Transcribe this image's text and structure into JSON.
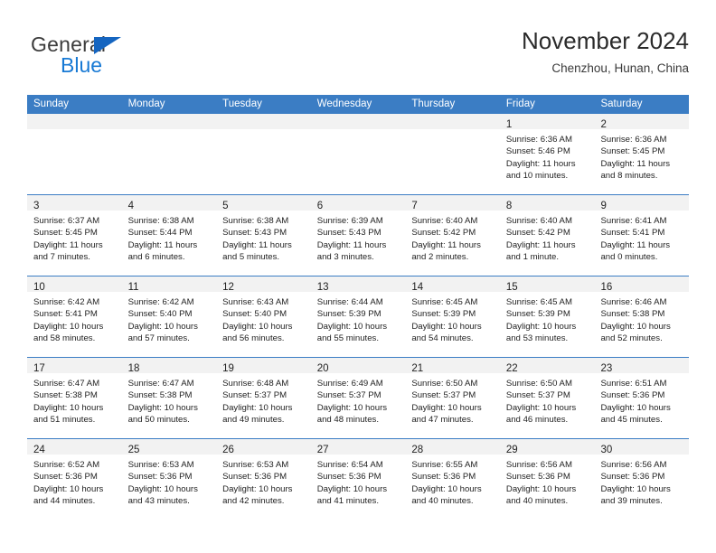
{
  "brand": {
    "name_top": "General",
    "name_bottom": "Blue",
    "accent_color": "#1779d4",
    "triangle_color": "#1565c0"
  },
  "header": {
    "title": "November 2024",
    "subtitle": "Chenzhou, Hunan, China"
  },
  "theme": {
    "header_row_bg": "#3b7dc4",
    "day_band_bg": "#f2f2f2",
    "row_divider": "#3b7dc4"
  },
  "weekdays": [
    "Sunday",
    "Monday",
    "Tuesday",
    "Wednesday",
    "Thursday",
    "Friday",
    "Saturday"
  ],
  "weeks": [
    [
      {
        "day": "",
        "sunrise": "",
        "sunset": "",
        "daylight": "",
        "daylight2": ""
      },
      {
        "day": "",
        "sunrise": "",
        "sunset": "",
        "daylight": "",
        "daylight2": ""
      },
      {
        "day": "",
        "sunrise": "",
        "sunset": "",
        "daylight": "",
        "daylight2": ""
      },
      {
        "day": "",
        "sunrise": "",
        "sunset": "",
        "daylight": "",
        "daylight2": ""
      },
      {
        "day": "",
        "sunrise": "",
        "sunset": "",
        "daylight": "",
        "daylight2": ""
      },
      {
        "day": "1",
        "sunrise": "Sunrise: 6:36 AM",
        "sunset": "Sunset: 5:46 PM",
        "daylight": "Daylight: 11 hours",
        "daylight2": "and 10 minutes."
      },
      {
        "day": "2",
        "sunrise": "Sunrise: 6:36 AM",
        "sunset": "Sunset: 5:45 PM",
        "daylight": "Daylight: 11 hours",
        "daylight2": "and 8 minutes."
      }
    ],
    [
      {
        "day": "3",
        "sunrise": "Sunrise: 6:37 AM",
        "sunset": "Sunset: 5:45 PM",
        "daylight": "Daylight: 11 hours",
        "daylight2": "and 7 minutes."
      },
      {
        "day": "4",
        "sunrise": "Sunrise: 6:38 AM",
        "sunset": "Sunset: 5:44 PM",
        "daylight": "Daylight: 11 hours",
        "daylight2": "and 6 minutes."
      },
      {
        "day": "5",
        "sunrise": "Sunrise: 6:38 AM",
        "sunset": "Sunset: 5:43 PM",
        "daylight": "Daylight: 11 hours",
        "daylight2": "and 5 minutes."
      },
      {
        "day": "6",
        "sunrise": "Sunrise: 6:39 AM",
        "sunset": "Sunset: 5:43 PM",
        "daylight": "Daylight: 11 hours",
        "daylight2": "and 3 minutes."
      },
      {
        "day": "7",
        "sunrise": "Sunrise: 6:40 AM",
        "sunset": "Sunset: 5:42 PM",
        "daylight": "Daylight: 11 hours",
        "daylight2": "and 2 minutes."
      },
      {
        "day": "8",
        "sunrise": "Sunrise: 6:40 AM",
        "sunset": "Sunset: 5:42 PM",
        "daylight": "Daylight: 11 hours",
        "daylight2": "and 1 minute."
      },
      {
        "day": "9",
        "sunrise": "Sunrise: 6:41 AM",
        "sunset": "Sunset: 5:41 PM",
        "daylight": "Daylight: 11 hours",
        "daylight2": "and 0 minutes."
      }
    ],
    [
      {
        "day": "10",
        "sunrise": "Sunrise: 6:42 AM",
        "sunset": "Sunset: 5:41 PM",
        "daylight": "Daylight: 10 hours",
        "daylight2": "and 58 minutes."
      },
      {
        "day": "11",
        "sunrise": "Sunrise: 6:42 AM",
        "sunset": "Sunset: 5:40 PM",
        "daylight": "Daylight: 10 hours",
        "daylight2": "and 57 minutes."
      },
      {
        "day": "12",
        "sunrise": "Sunrise: 6:43 AM",
        "sunset": "Sunset: 5:40 PM",
        "daylight": "Daylight: 10 hours",
        "daylight2": "and 56 minutes."
      },
      {
        "day": "13",
        "sunrise": "Sunrise: 6:44 AM",
        "sunset": "Sunset: 5:39 PM",
        "daylight": "Daylight: 10 hours",
        "daylight2": "and 55 minutes."
      },
      {
        "day": "14",
        "sunrise": "Sunrise: 6:45 AM",
        "sunset": "Sunset: 5:39 PM",
        "daylight": "Daylight: 10 hours",
        "daylight2": "and 54 minutes."
      },
      {
        "day": "15",
        "sunrise": "Sunrise: 6:45 AM",
        "sunset": "Sunset: 5:39 PM",
        "daylight": "Daylight: 10 hours",
        "daylight2": "and 53 minutes."
      },
      {
        "day": "16",
        "sunrise": "Sunrise: 6:46 AM",
        "sunset": "Sunset: 5:38 PM",
        "daylight": "Daylight: 10 hours",
        "daylight2": "and 52 minutes."
      }
    ],
    [
      {
        "day": "17",
        "sunrise": "Sunrise: 6:47 AM",
        "sunset": "Sunset: 5:38 PM",
        "daylight": "Daylight: 10 hours",
        "daylight2": "and 51 minutes."
      },
      {
        "day": "18",
        "sunrise": "Sunrise: 6:47 AM",
        "sunset": "Sunset: 5:38 PM",
        "daylight": "Daylight: 10 hours",
        "daylight2": "and 50 minutes."
      },
      {
        "day": "19",
        "sunrise": "Sunrise: 6:48 AM",
        "sunset": "Sunset: 5:37 PM",
        "daylight": "Daylight: 10 hours",
        "daylight2": "and 49 minutes."
      },
      {
        "day": "20",
        "sunrise": "Sunrise: 6:49 AM",
        "sunset": "Sunset: 5:37 PM",
        "daylight": "Daylight: 10 hours",
        "daylight2": "and 48 minutes."
      },
      {
        "day": "21",
        "sunrise": "Sunrise: 6:50 AM",
        "sunset": "Sunset: 5:37 PM",
        "daylight": "Daylight: 10 hours",
        "daylight2": "and 47 minutes."
      },
      {
        "day": "22",
        "sunrise": "Sunrise: 6:50 AM",
        "sunset": "Sunset: 5:37 PM",
        "daylight": "Daylight: 10 hours",
        "daylight2": "and 46 minutes."
      },
      {
        "day": "23",
        "sunrise": "Sunrise: 6:51 AM",
        "sunset": "Sunset: 5:36 PM",
        "daylight": "Daylight: 10 hours",
        "daylight2": "and 45 minutes."
      }
    ],
    [
      {
        "day": "24",
        "sunrise": "Sunrise: 6:52 AM",
        "sunset": "Sunset: 5:36 PM",
        "daylight": "Daylight: 10 hours",
        "daylight2": "and 44 minutes."
      },
      {
        "day": "25",
        "sunrise": "Sunrise: 6:53 AM",
        "sunset": "Sunset: 5:36 PM",
        "daylight": "Daylight: 10 hours",
        "daylight2": "and 43 minutes."
      },
      {
        "day": "26",
        "sunrise": "Sunrise: 6:53 AM",
        "sunset": "Sunset: 5:36 PM",
        "daylight": "Daylight: 10 hours",
        "daylight2": "and 42 minutes."
      },
      {
        "day": "27",
        "sunrise": "Sunrise: 6:54 AM",
        "sunset": "Sunset: 5:36 PM",
        "daylight": "Daylight: 10 hours",
        "daylight2": "and 41 minutes."
      },
      {
        "day": "28",
        "sunrise": "Sunrise: 6:55 AM",
        "sunset": "Sunset: 5:36 PM",
        "daylight": "Daylight: 10 hours",
        "daylight2": "and 40 minutes."
      },
      {
        "day": "29",
        "sunrise": "Sunrise: 6:56 AM",
        "sunset": "Sunset: 5:36 PM",
        "daylight": "Daylight: 10 hours",
        "daylight2": "and 40 minutes."
      },
      {
        "day": "30",
        "sunrise": "Sunrise: 6:56 AM",
        "sunset": "Sunset: 5:36 PM",
        "daylight": "Daylight: 10 hours",
        "daylight2": "and 39 minutes."
      }
    ]
  ]
}
